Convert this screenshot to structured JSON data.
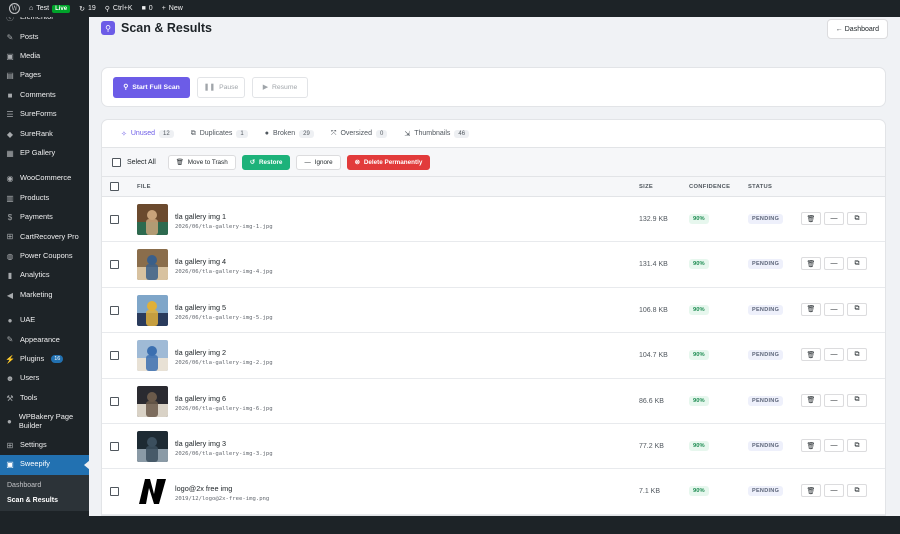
{
  "admin_bar": {
    "site_name": "Test",
    "live_label": "Live",
    "updates_count": "19",
    "search_shortcut": "Ctrl+K",
    "comments_count": "0",
    "new_label": "New"
  },
  "sidebar": {
    "items": [
      {
        "label": "Elementor",
        "icon": "elementor-icon"
      },
      {
        "label": "Posts",
        "icon": "pin-icon"
      },
      {
        "label": "Media",
        "icon": "media-icon"
      },
      {
        "label": "Pages",
        "icon": "pages-icon"
      },
      {
        "label": "Comments",
        "icon": "comment-icon"
      },
      {
        "label": "SureForms",
        "icon": "form-icon"
      },
      {
        "label": "SureRank",
        "icon": "rank-icon"
      },
      {
        "label": "EP Gallery",
        "icon": "gallery-icon"
      },
      {
        "label": "WooCommerce",
        "icon": "woo-icon"
      },
      {
        "label": "Products",
        "icon": "products-icon"
      },
      {
        "label": "Payments",
        "icon": "payments-icon"
      },
      {
        "label": "CartRecovery Pro",
        "icon": "cart-icon"
      },
      {
        "label": "Power Coupons",
        "icon": "coupon-icon"
      },
      {
        "label": "Analytics",
        "icon": "analytics-icon"
      },
      {
        "label": "Marketing",
        "icon": "megaphone-icon"
      },
      {
        "label": "UAE",
        "icon": "uae-icon"
      },
      {
        "label": "Appearance",
        "icon": "brush-icon"
      },
      {
        "label": "Plugins",
        "icon": "plugin-icon",
        "badge": "16"
      },
      {
        "label": "Users",
        "icon": "users-icon"
      },
      {
        "label": "Tools",
        "icon": "tools-icon"
      },
      {
        "label": "WPBakery Page Builder",
        "icon": "wpbakery-icon"
      },
      {
        "label": "Settings",
        "icon": "settings-icon"
      },
      {
        "label": "Sweepify",
        "icon": "sweepify-icon"
      }
    ],
    "submenu": [
      "Dashboard",
      "Scan & Results"
    ]
  },
  "page": {
    "title": "Scan & Results",
    "back_button": "← Dashboard"
  },
  "scan_controls": {
    "start": "Start Full Scan",
    "pause": "Pause",
    "resume": "Resume"
  },
  "tabs": [
    {
      "label": "Unused",
      "count": "12",
      "active": true
    },
    {
      "label": "Duplicates",
      "count": "1"
    },
    {
      "label": "Broken",
      "count": "29"
    },
    {
      "label": "Oversized",
      "count": "0"
    },
    {
      "label": "Thumbnails",
      "count": "46"
    }
  ],
  "bulk_actions": {
    "select_all": "Select All",
    "move_to_trash": "Move to Trash",
    "restore": "Restore",
    "ignore": "Ignore",
    "delete_permanently": "Delete Permanently"
  },
  "table": {
    "headers": {
      "file": "FILE",
      "size": "SIZE",
      "confidence": "CONFIDENCE",
      "status": "STATUS"
    },
    "rows": [
      {
        "name": "tla gallery img 1",
        "path": "2026/06/tla-gallery-img-1.jpg",
        "size": "132.9 KB",
        "confidence": "90%",
        "status": "PENDING",
        "thumb": [
          "#6b4a2e",
          "#c9a37a",
          "#2d6a4f"
        ]
      },
      {
        "name": "tla gallery img 4",
        "path": "2026/06/tla-gallery-img-4.jpg",
        "size": "131.4 KB",
        "confidence": "90%",
        "status": "PENDING",
        "thumb": [
          "#8a6d4b",
          "#3a5f8a",
          "#d8c2a0"
        ]
      },
      {
        "name": "tla gallery img 5",
        "path": "2026/06/tla-gallery-img-5.jpg",
        "size": "106.8 KB",
        "confidence": "90%",
        "status": "PENDING",
        "thumb": [
          "#7fa6c9",
          "#e0b03a",
          "#2a3b5c"
        ]
      },
      {
        "name": "tla gallery img 2",
        "path": "2026/06/tla-gallery-img-2.jpg",
        "size": "104.7 KB",
        "confidence": "90%",
        "status": "PENDING",
        "thumb": [
          "#9fbad6",
          "#3b6fb0",
          "#e8e1d5"
        ]
      },
      {
        "name": "tla gallery img 6",
        "path": "2026/06/tla-gallery-img-6.jpg",
        "size": "86.6 KB",
        "confidence": "90%",
        "status": "PENDING",
        "thumb": [
          "#2a2a30",
          "#6b5a4a",
          "#d9d2c6"
        ]
      },
      {
        "name": "tla gallery img 3",
        "path": "2026/06/tla-gallery-img-3.jpg",
        "size": "77.2 KB",
        "confidence": "90%",
        "status": "PENDING",
        "thumb": [
          "#1d2a33",
          "#3b4f5e",
          "#8a9aa6"
        ]
      },
      {
        "name": "logo@2x free img",
        "path": "2019/12/logo@2x-free-img.png",
        "size": "7.1 KB",
        "confidence": "90%",
        "status": "PENDING",
        "thumb": [
          "#ffffff",
          "#000000",
          "#000000"
        ]
      }
    ]
  },
  "colors": {
    "accent": "#6c5ce7",
    "success": "#1db27a",
    "danger": "#e23b3b",
    "admin_dark": "#1d2327"
  }
}
